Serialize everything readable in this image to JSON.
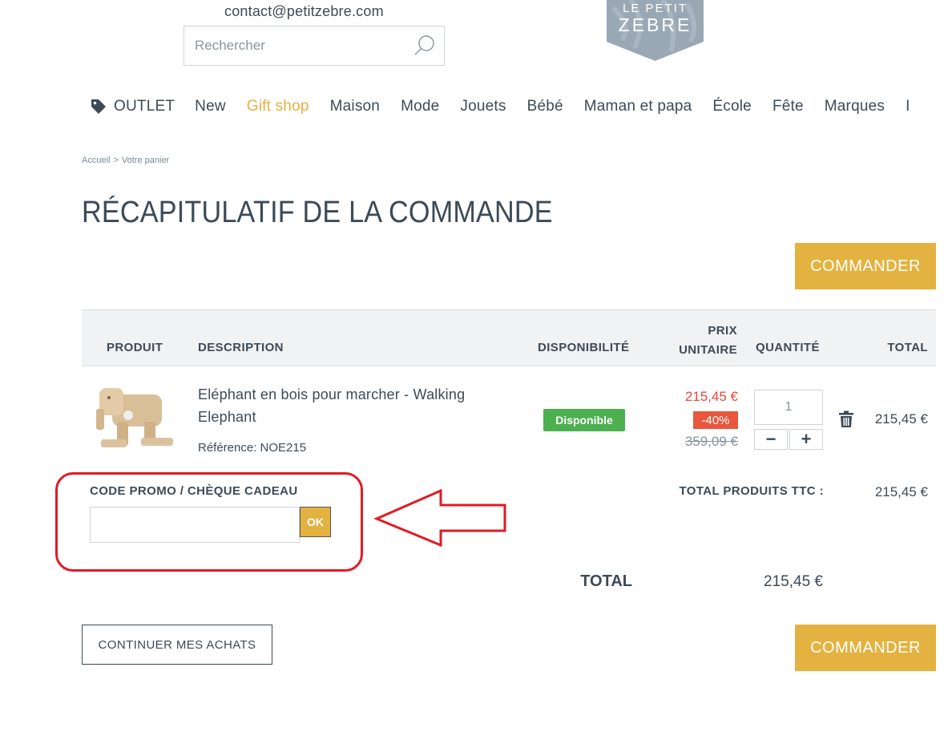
{
  "header": {
    "contact_email": "contact@petitzebre.com",
    "search": {
      "placeholder": "Rechercher",
      "icon": "search-icon"
    },
    "logo": {
      "line1": "LE PETIT",
      "line2": "ZEBRE",
      "color": "#9aa8b5"
    }
  },
  "nav": {
    "items": [
      {
        "label": "OUTLET",
        "icon": "tag-icon"
      },
      {
        "label": "New"
      },
      {
        "label": "Gift shop",
        "accent": "#e6b03e"
      },
      {
        "label": "Maison"
      },
      {
        "label": "Mode"
      },
      {
        "label": "Jouets"
      },
      {
        "label": "Bébé"
      },
      {
        "label": "Maman et papa"
      },
      {
        "label": "École"
      },
      {
        "label": "Fête"
      },
      {
        "label": "Marques"
      },
      {
        "label": "I"
      }
    ]
  },
  "breadcrumb": {
    "home": "Accueil",
    "separator": ">",
    "current": "Votre panier"
  },
  "page": {
    "title": "RÉCAPITULATIF DE LA COMMANDE",
    "order_button": "COMMANDER",
    "accent_color": "#e3b240"
  },
  "table": {
    "headers": {
      "produit": "PRODUIT",
      "description": "DESCRIPTION",
      "disponibilite": "DISPONIBILITÉ",
      "prix_line1": "PRIX",
      "prix_line2": "UNITAIRE",
      "quantite": "QUANTITÉ",
      "total": "TOTAL"
    },
    "rows": [
      {
        "name": "Eléphant en bois pour marcher - Walking Elephant",
        "reference": "Référence: NOE215",
        "availability": "Disponible",
        "price_now": "215,45 €",
        "discount": "-40%",
        "price_old": "359,09 €",
        "quantity": "1",
        "qty_minus": "−",
        "qty_plus": "+",
        "total": "215,45 €",
        "delete_icon": "trash-icon"
      }
    ]
  },
  "promo": {
    "label": "CODE PROMO / CHÈQUE CADEAU",
    "input_value": "",
    "ok_label": "OK"
  },
  "summary": {
    "products_label": "TOTAL PRODUITS TTC :",
    "products_value": "215,45 €",
    "total_label": "TOTAL",
    "total_value": "215,45 €"
  },
  "actions": {
    "continue_label": "CONTINUER MES ACHATS"
  },
  "annotation": {
    "color": "#e11b22"
  }
}
